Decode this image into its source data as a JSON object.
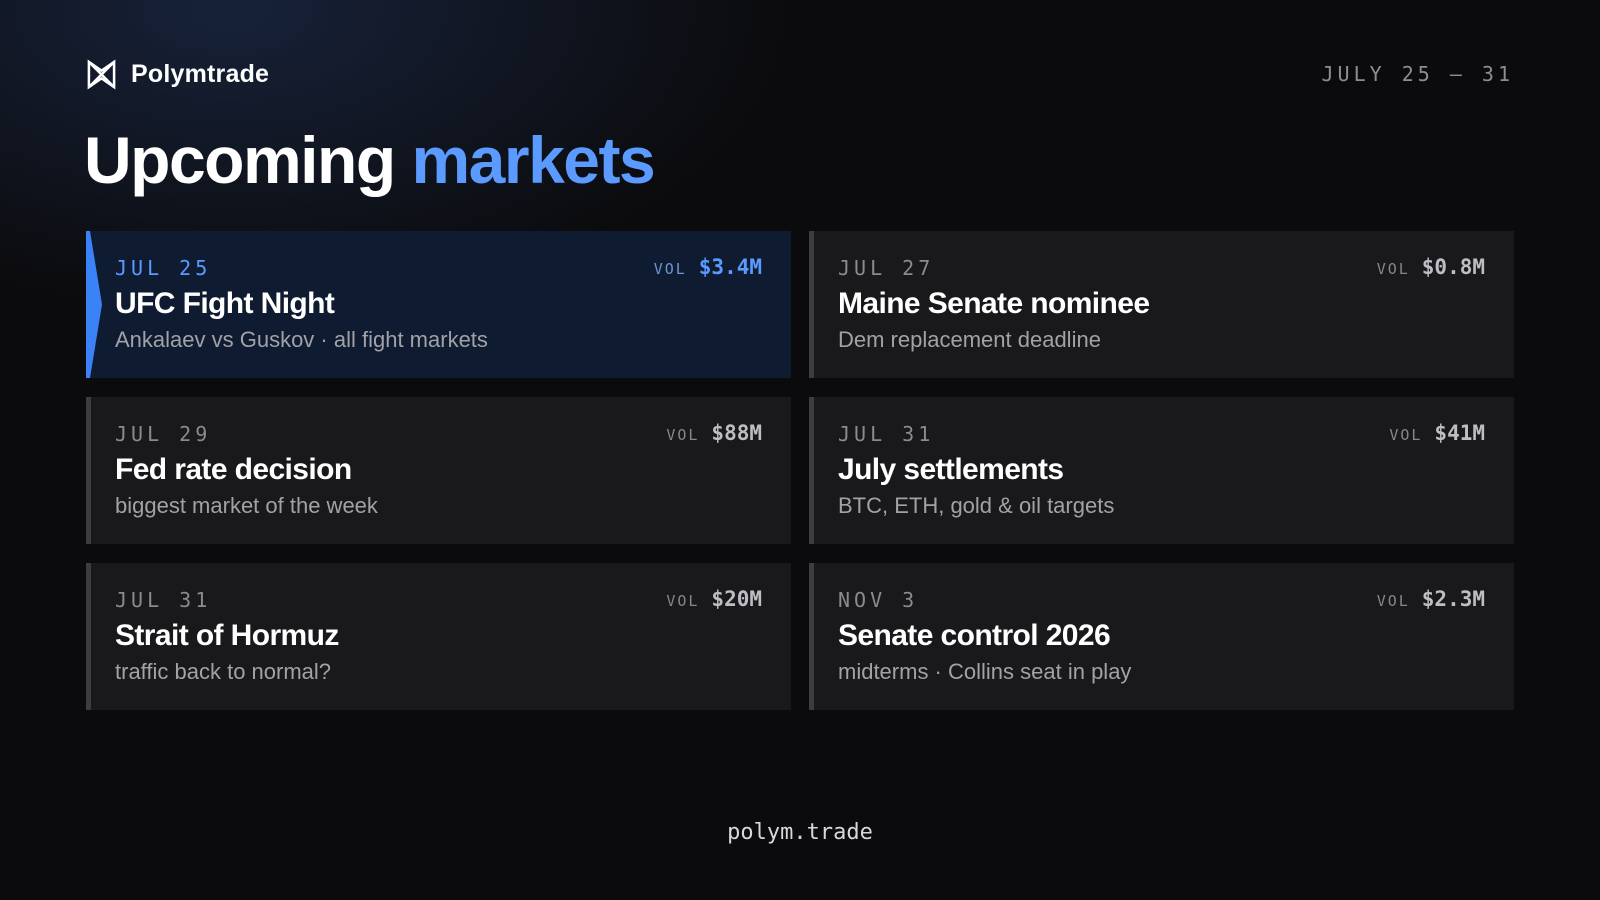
{
  "brand": {
    "name": "Polymtrade",
    "logo_icon": "bowtie-x-logo-icon"
  },
  "header": {
    "date_range": "JULY 25 — 31"
  },
  "headline": {
    "word1": "Upcoming",
    "word2": "markets"
  },
  "colors": {
    "accent": "#3b82f6",
    "accent_text": "#5b9bff",
    "card_bg": "#19191c",
    "active_card_bg": "#0f1b31",
    "page_bg": "#0b0b0d"
  },
  "vol_label": "VOL",
  "markets": [
    {
      "date": "JUL 25",
      "volume": "$3.4M",
      "title": "UFC Fight Night",
      "subtitle": "Ankalaev vs Guskov · all fight markets",
      "highlighted": true
    },
    {
      "date": "JUL 27",
      "volume": "$0.8M",
      "title": "Maine Senate nominee",
      "subtitle": "Dem replacement deadline",
      "highlighted": false
    },
    {
      "date": "JUL 29",
      "volume": "$88M",
      "title": "Fed rate decision",
      "subtitle": "biggest market of the week",
      "highlighted": false
    },
    {
      "date": "JUL 31",
      "volume": "$41M",
      "title": "July settlements",
      "subtitle": "BTC, ETH, gold & oil targets",
      "highlighted": false
    },
    {
      "date": "JUL 31",
      "volume": "$20M",
      "title": "Strait of Hormuz",
      "subtitle": "traffic back to normal?",
      "highlighted": false
    },
    {
      "date": "NOV 3",
      "volume": "$2.3M",
      "title": "Senate control 2026",
      "subtitle": "midterms · Collins seat in play",
      "highlighted": false
    }
  ],
  "footer": {
    "url": "polym.trade"
  }
}
